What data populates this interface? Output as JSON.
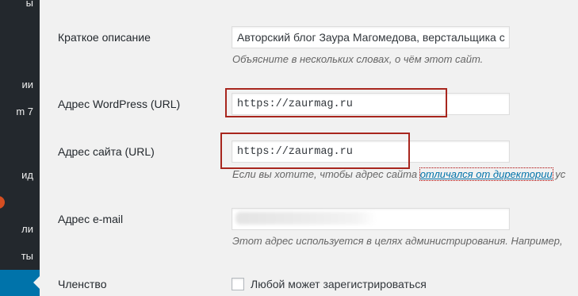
{
  "sidebar": {
    "items": [
      {
        "label": "ы"
      },
      {
        "label": "ии"
      },
      {
        "label": "m 7"
      },
      {
        "label": "ид"
      },
      {
        "label": "ли"
      },
      {
        "label": "ты"
      }
    ]
  },
  "settings": {
    "tagline": {
      "label": "Краткое описание",
      "value": "Авторский блог Заура Магомедова, верстальщика с",
      "description": "Объясните в нескольких словах, о чём этот сайт."
    },
    "wp_url": {
      "label": "Адрес WordPress (URL)",
      "value": "https://zaurmag.ru"
    },
    "site_url": {
      "label": "Адрес сайта (URL)",
      "value": "https://zaurmag.ru",
      "description_before": "Если вы хотите, чтобы адрес сайта ",
      "description_link": "отличался от директории",
      "description_after": " ус"
    },
    "email": {
      "label": "Адрес e-mail",
      "description": "Этот адрес используется в целях администрирования. Например,"
    },
    "membership": {
      "label": "Членство",
      "checkbox_label": "Любой может зарегистрироваться",
      "checked": false
    }
  },
  "colors": {
    "sidebar_bg": "#23282d",
    "active_menu": "#0073aa",
    "highlight_box": "#a8261e",
    "link": "#0073aa"
  }
}
